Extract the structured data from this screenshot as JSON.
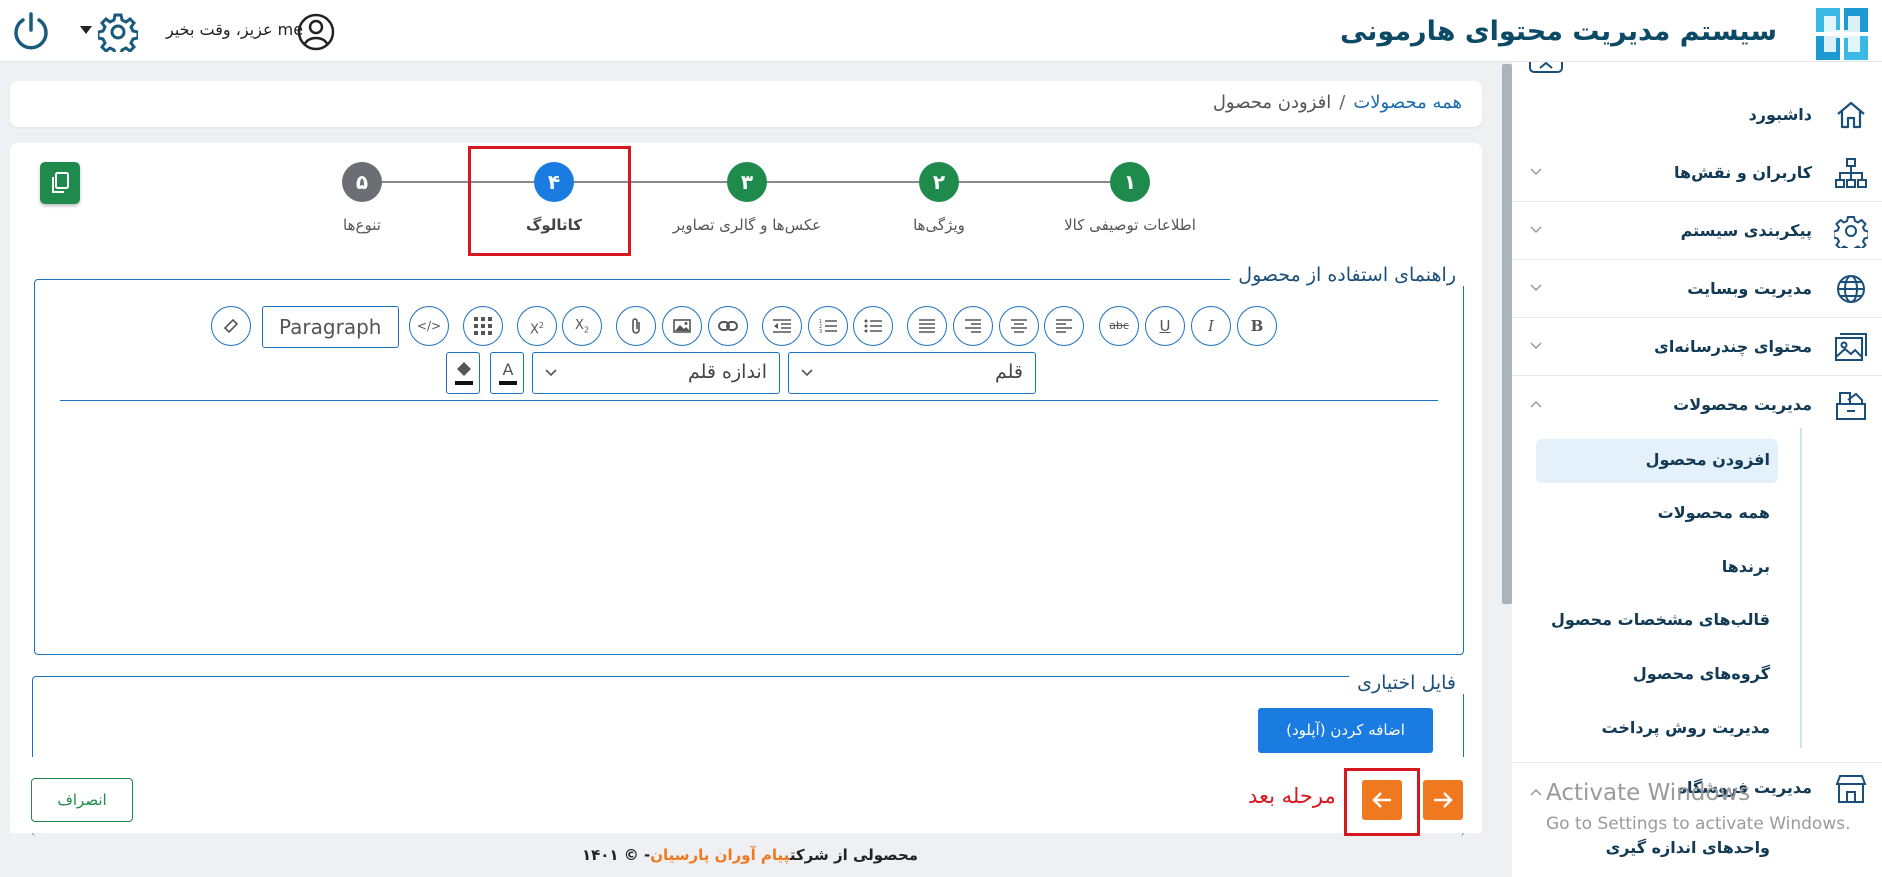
{
  "header": {
    "app_title": "سیستم مدیریت محتوای هارمونی",
    "greeting": "me عزیز، وقت بخیر"
  },
  "sidebar": {
    "items": [
      {
        "label": "داشبورد",
        "icon": "home-icon"
      },
      {
        "label": "کاربران و نقش‌ها",
        "icon": "org-chart-icon"
      },
      {
        "label": "پیکربندی سیستم",
        "icon": "gear-icon"
      },
      {
        "label": "مدیریت وبسایت",
        "icon": "globe-icon"
      },
      {
        "label": "محتوای چندرسانه‌ای",
        "icon": "gallery-icon"
      },
      {
        "label": "مدیریت محصولات",
        "icon": "products-icon"
      },
      {
        "label": "مدیریت فروشگاه",
        "icon": "store-icon"
      }
    ],
    "subitems": [
      "افزودن محصول",
      "همه محصولات",
      "برندها",
      "قالب‌های مشخصات محصول",
      "گروه‌های محصول",
      "مدیریت روش پرداخت"
    ],
    "last_subitem": "واحدهای اندازه گیری"
  },
  "breadcrumb": {
    "parent": "همه محصولات",
    "separator": "/",
    "current": "افزودن محصول"
  },
  "steps": [
    {
      "num": "۱",
      "label": "اطلاعات توصیفی کالا",
      "color": "#1e8a4c"
    },
    {
      "num": "۲",
      "label": "ویژگی‌ها",
      "color": "#1e8a4c"
    },
    {
      "num": "۳",
      "label": "عکس‌ها و گالری تصاویر",
      "color": "#1e8a4c"
    },
    {
      "num": "۴",
      "label": "کاتالوگ",
      "color": "#1a7be0"
    },
    {
      "num": "۵",
      "label": "تنوع‌ها",
      "color": "#6b6f73"
    }
  ],
  "editor": {
    "legend": "راهنمای استفاده از محصول",
    "paragraph": "Paragraph",
    "font_select": "قلم",
    "font_size_select": "اندازه قلم"
  },
  "file_section": {
    "legend": "فایل اختیاری",
    "upload_button": "اضافه کردن (آپلود)"
  },
  "actions": {
    "cancel": "انصراف",
    "next_label": "مرحله بعد"
  },
  "footer": {
    "prefix": "محصولی از شرکت",
    "company": "پیام آوران پارسیان",
    "suffix": "- © ۱۴۰۱"
  },
  "windows_watermark": {
    "line1": "Activate Windows",
    "line2": "Go to Settings to activate Windows."
  },
  "colors": {
    "primary": "#1a7be0",
    "success": "#1e8a4c",
    "accent": "#f0781e",
    "highlight": "#d8181f"
  }
}
